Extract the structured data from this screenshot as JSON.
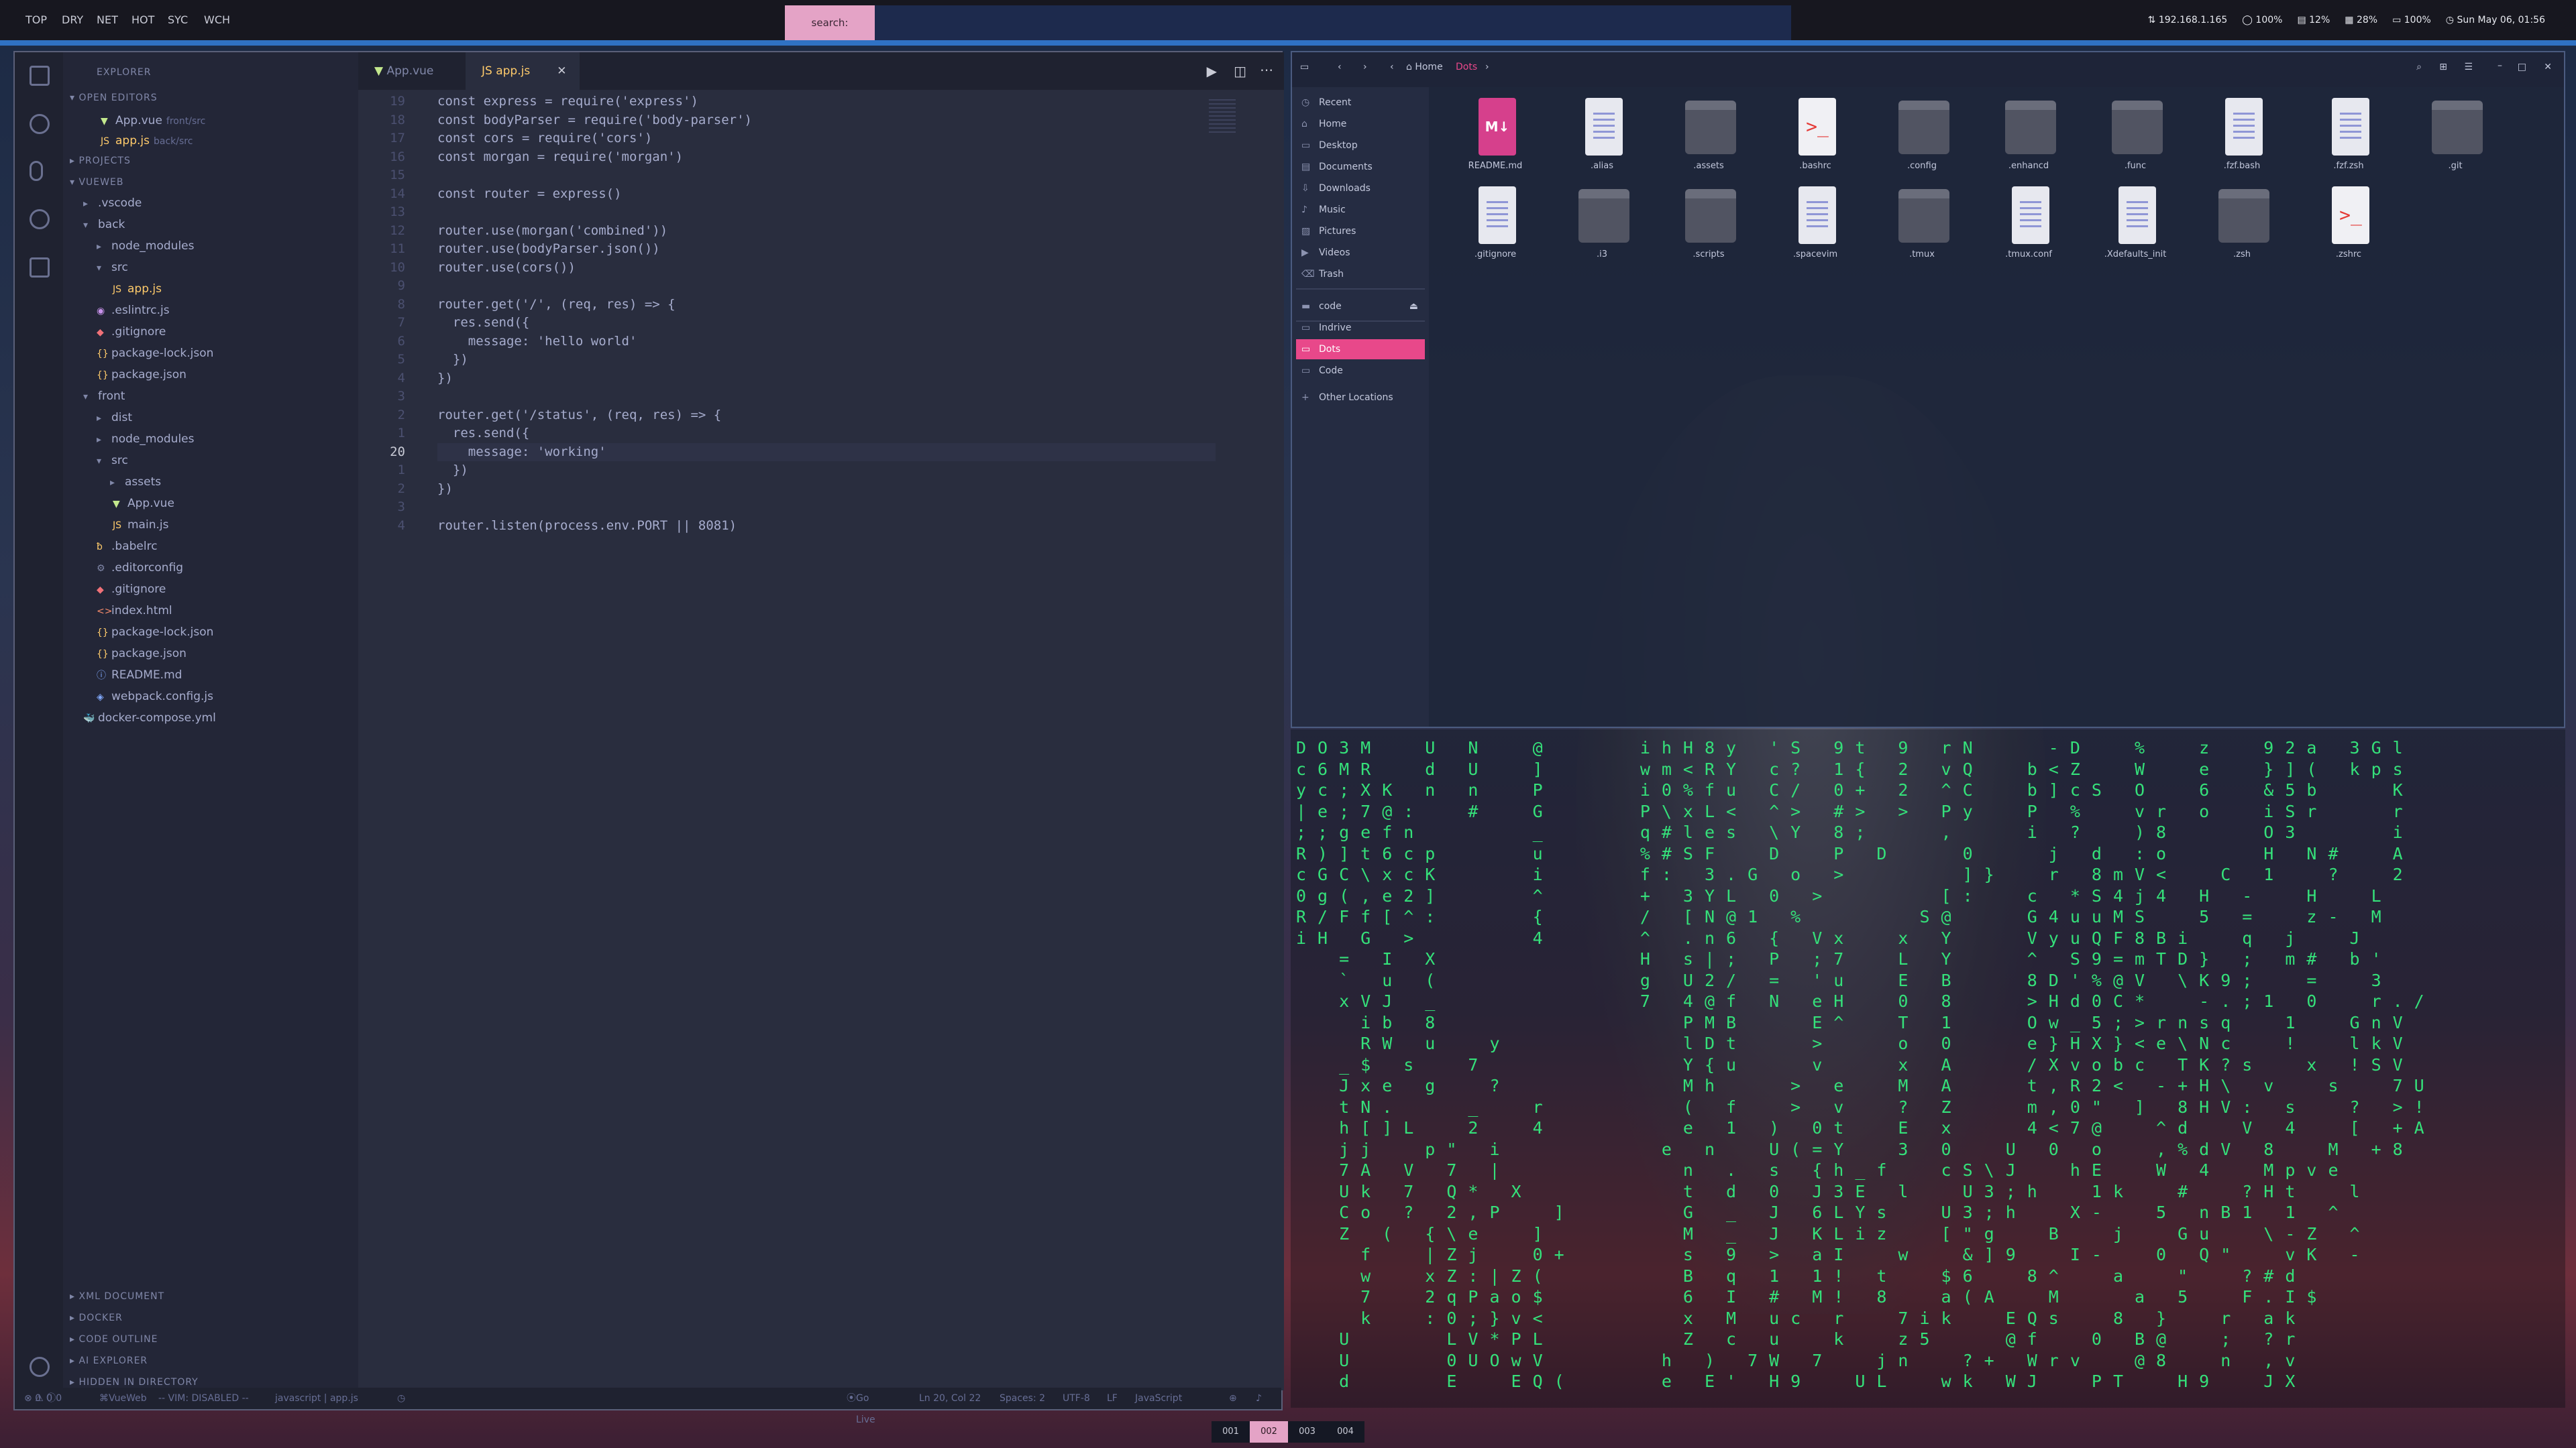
{
  "topbar": {
    "workspaces": [
      "TOP",
      "DRY",
      "NET",
      "HOT",
      "SYC",
      "WCH"
    ],
    "search_label": "search:",
    "status": [
      "192.168.1.165",
      "100%",
      "12%",
      "28%",
      "100%",
      "Sun May 06, 01:56"
    ]
  },
  "vscode": {
    "explorer_title": "EXPLORER",
    "sections": {
      "open_editors": "OPEN EDITORS",
      "projects": "PROJECTS",
      "vueweb": "VUEWEB",
      "xml": "XML DOCUMENT",
      "docker": "DOCKER",
      "outline": "CODE OUTLINE",
      "ai": "AI EXPLORER",
      "hidden": "HIDDEN IN DIRECTORY"
    },
    "open_editors": [
      {
        "name": "App.vue",
        "path": "front/src"
      },
      {
        "name": "app.js",
        "path": "back/src"
      }
    ],
    "tree": [
      ".vscode",
      "back",
      "node_modules",
      "src",
      "app.js",
      ".eslintrc.js",
      ".gitignore",
      "package-lock.json",
      "package.json",
      "front",
      "dist",
      "node_modules",
      "src",
      "assets",
      "App.vue",
      "main.js",
      ".babelrc",
      ".editorconfig",
      ".gitignore",
      "index.html",
      "package-lock.json",
      "package.json",
      "README.md",
      "webpack.config.js",
      "docker-compose.yml"
    ],
    "tabs": [
      "App.vue",
      "app.js"
    ],
    "line_numbers": [
      "19",
      "18",
      "17",
      "16",
      "15",
      "14",
      "13",
      "12",
      "11",
      "10",
      "9",
      "8",
      "7",
      "6",
      "5",
      "4",
      "3",
      "2",
      "1",
      "20",
      "1",
      "2",
      "3",
      "4"
    ],
    "code_lines": [
      "const express = require('express')",
      "const bodyParser = require('body-parser')",
      "const cors = require('cors')",
      "const morgan = require('morgan')",
      "",
      "const router = express()",
      "",
      "router.use(morgan('combined'))",
      "router.use(bodyParser.json())",
      "router.use(cors())",
      "",
      "router.get('/', (req, res) => {",
      "  res.send({",
      "    message: 'hello world'",
      "  })",
      "})",
      "",
      "router.get('/status', (req, res) => {",
      "  res.send({",
      "    message: 'working'",
      "  })",
      "})",
      "",
      "router.listen(process.env.PORT || 8081)"
    ],
    "statusbar": {
      "errors": "0",
      "warnings": "0",
      "info": "0",
      "project": "VueWeb",
      "vim": "-- VIM: DISABLED --",
      "file": "javascript | app.js",
      "golive": "Go Live",
      "pos": "Ln 20, Col 22",
      "spaces": "Spaces: 2",
      "enc": "UTF-8",
      "eol": "LF",
      "lang": "JavaScript"
    }
  },
  "files": {
    "breadcrumb": [
      "Home",
      "Dots"
    ],
    "sidebar": [
      "Recent",
      "Home",
      "Desktop",
      "Documents",
      "Downloads",
      "Music",
      "Pictures",
      "Videos",
      "Trash"
    ],
    "sidebar2": [
      "code",
      "Indrive",
      "Dots",
      "Code",
      "Other Locations"
    ],
    "items": [
      {
        "name": "README.md",
        "kind": "md"
      },
      {
        "name": ".alias",
        "kind": "doc"
      },
      {
        "name": ".assets",
        "kind": "folder"
      },
      {
        "name": ".bashrc",
        "kind": "term"
      },
      {
        "name": ".config",
        "kind": "folder"
      },
      {
        "name": ".enhancd",
        "kind": "folder"
      },
      {
        "name": ".func",
        "kind": "folder"
      },
      {
        "name": ".fzf.bash",
        "kind": "doc"
      },
      {
        "name": ".fzf.zsh",
        "kind": "doc"
      },
      {
        "name": ".git",
        "kind": "folder"
      },
      {
        "name": ".gitignore",
        "kind": "doc"
      },
      {
        "name": ".i3",
        "kind": "folder"
      },
      {
        "name": ".scripts",
        "kind": "folder"
      },
      {
        "name": ".spacevim",
        "kind": "doc"
      },
      {
        "name": ".tmux",
        "kind": "folder"
      },
      {
        "name": ".tmux.conf",
        "kind": "doc"
      },
      {
        "name": ".Xdefaults_init",
        "kind": "doc"
      },
      {
        "name": ".zsh",
        "kind": "folder"
      },
      {
        "name": ".zshrc",
        "kind": "term"
      }
    ]
  },
  "terminal": {
    "rows": [
      "DO3M  U N  @    ihH8y 'S 9t 9 rN   -D  %  z  92a 3Gl",
      "c6MR  d U  ]    wm<RY c? 1{ 2 vQ  b<Z  W  e  }]( kps",
      "yc;XK n n  P    i0%fu C/ 0+ 2 ^C  b]cS O  6  &5b   K",
      "|e;7@:  #  G    P\\xL< ^> #> > Py  P %  vr o  iSr   r",
      ";;gefn     _    q#les \\Y 8;   ,   i ?  )8    O3    i",
      "R)]t6cp    u    %#SF  D  P D   0   j d :o    H N#  A",
      "cGC\\xcK    i    f: 3.G o >     ]}  r 8mV<  C 1  ?  2",
      "0g(,e2]    ^    + 3YL 0 >     [:  c *S4j4 H -  H  L",
      "R/Ff[^:    {    / [N@1 %     S@   G4uuMS  5 =  z- M",
      "iH G >     4    ^ .n6 { Vx  x Y   VyuQF8Bi  q j  J",
      "  = I X         H s|; P ;7  L Y   ^ S9=mTD} ; m# b'",
      "  ` u (         g U2/ = 'u  E B   8D'%@V \\K9;  =  3",
      "  xVJ _         7 4@f N eH  0 8   >Hd0C*  -.;1 0  r./",
      "   ib 8           PMB   E^  T 1   Ow_5;>rnsq  1  GnV",
      "   RW u  y        lDt   >   o 0   e}HX}<e\\Nc  !  lkV",
      "  _$ s  7         Y{u   v   x A   /Xvobc TK?s  x !SV",
      "  Jxe g  ?        Mh   > e  M A   t,R2< -+H\\ v  s  7U",
      "  tN.   _  r      ( f  > v  ? Z   m,0\" ] 8HV: s  ? >!",
      "  h[]L  2  4      e 1 ) 0t  E x   4<7@  ^d  V 4  [ +A",
      "  jj  p\" i       e n  U(=Y  3 0  U 0 o  ,%dV 8  M +8",
      "  7A V 7 |        n . s {h_f  cS\\J  hE  W 4  Mpve",
      "  Uk 7 Q* X       t d 0 J3E l  U3;h  1k  #  ?Ht  l",
      "  Co ? 2,P  ]     G _ J 6LYs  U3;h  X-  5 nB1 1 ^",
      "  Z ( {\\e  ]      M _ J KLiz  [\"g  B  j  Gu  \\-Z ^",
      "   f  |Zj  0+     s 9 > aI  w  &]9  I-  0 Q\"  vK -",
      "   w  xZ:|Z(      B q 1 1! t  $6  8^  a  \"  ?#d",
      "   7  2qPao$      6 I # M! 8  a(A  M   a 5  F.I$",
      "   k  :0;}v<      x M uc r  7ik  EQs  8 }  r ak",
      "  U    LV*PL      Z c u  k  z5   @f  0 B@  ; ?r",
      "  U    0UOwV     h ) 7W 7  jn  ?+ Wrv  @8  n ,v",
      "  d    E  EQ(    e E' H9  UL  wk WJ  PT  H9  JX"
    ]
  },
  "wsbar": [
    "001",
    "002",
    "003",
    "004"
  ]
}
